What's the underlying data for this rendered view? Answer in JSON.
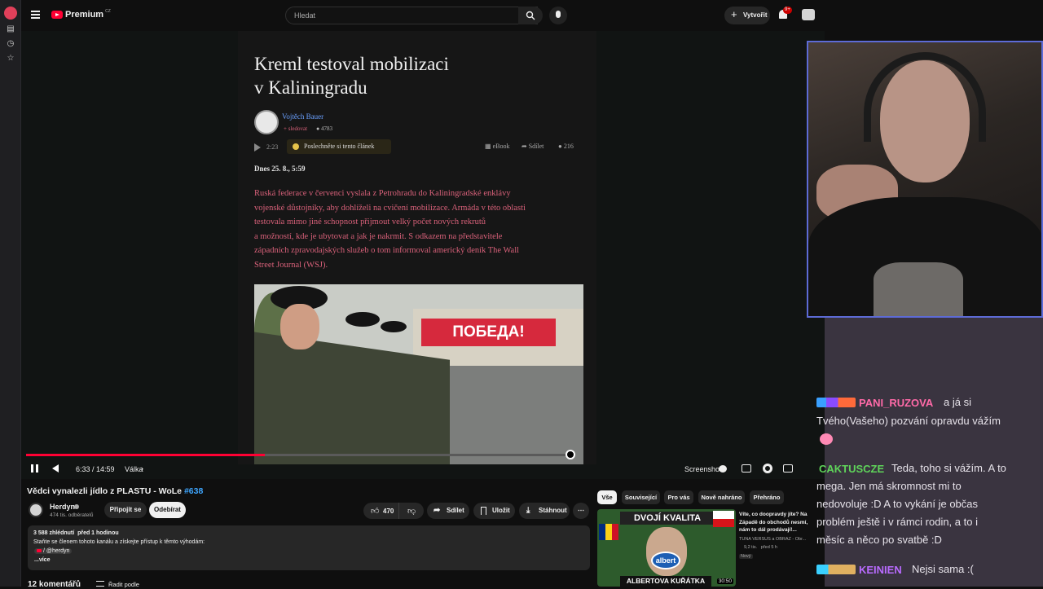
{
  "app": {
    "brand": "Premium",
    "country": "CZ",
    "search_placeholder": "Hledat",
    "create_label": "Vytvořit",
    "notif_badge": "9+"
  },
  "article": {
    "title_line1": "Kreml testoval mobilizaci",
    "title_line2": "v Kaliningradu",
    "author": "Vojtěch Bauer",
    "follow": "sledovat",
    "followers": "4783",
    "audio_time": "2:23",
    "listen_label": "Poslechněte si tento článek",
    "ebook": "eBook",
    "share": "Sdílet",
    "comments": "216",
    "date": "Dnes 25. 8., 5:59",
    "lead_lines": [
      "Ruská federace v červenci vyslala z Petrohradu do Kaliningradské enklávy",
      "vojenské důstojníky, aby dohlíželi na cvičení mobilizace. Armáda v této oblasti",
      "testovala mimo jiné schopnost přijmout velký počet nových rekrutů",
      "a možností, kde je ubytovat a jak je nakrmit. S odkazem na představitele",
      "západních zpravodajských služeb o tom informoval americký deník The Wall",
      "Street Journal (WSJ)."
    ],
    "photo_banner": "ПОБЕДА!"
  },
  "player": {
    "time": "6:33 / 14:59",
    "chapter": "Válka",
    "screenshot_label": "Screenshot",
    "progress": 0.437
  },
  "video": {
    "title": "Vědci vynalezli jídlo z PLASTU - WoLe",
    "tag": "#638",
    "channel": "Herdyn",
    "subscribers": "474 tis. odběratelů",
    "join": "Připojit se",
    "subscribe": "Odebírat",
    "likes": "470",
    "share": "Sdílet",
    "save": "Uložit",
    "download": "Stáhnout",
    "desc_stats": "3 588 zhlédnutí  před 1 hodinou",
    "desc_line": "Staňte se členem tohoto kanálu a získejte přístup k těmto výhodám:",
    "desc_link": "/ @herdyn",
    "desc_more": "...více",
    "comments_count": "12 komentářů",
    "sort_label": "Řadit podle"
  },
  "chips": [
    "Vše",
    "Související",
    "Pro vás",
    "Nově nahráno",
    "Přehráno"
  ],
  "rec": {
    "thumb_top": "DVOJÍ KVALITA",
    "thumb_bottom": "ALBERTOVA KUŘÁTKA",
    "thumb_brand": "albert",
    "duration": "30:50",
    "title": "Víte, co doopravdy jíte? Na Západě do obchodů nesmí, nám to dál prodávají!...",
    "channel": "TUNA VERSUS a OBRAZ - Obr...",
    "meta": "9,2 tis.   před 5 h",
    "badge": "Nový"
  },
  "chat": [
    {
      "name": "PANI_RUZOVA",
      "color": "#ff6aa8",
      "text_lines": [
        "a já si",
        "Tvého(Vašeho) pozvání opravdu vážím"
      ]
    },
    {
      "name": "CAKTUSCZE",
      "color": "#5fd45a",
      "text_lines": [
        "Teda, toho si vážím. A to",
        "mega. Jen má skromnost mi to",
        "nedovoluje :D A to vykání je občas",
        "problém ještě i v rámci rodin, a to i",
        "měsíc a něco po svatbě :D"
      ]
    },
    {
      "name": "KEINIEN",
      "color": "#b96bff",
      "text_lines": [
        "Nejsi sama :("
      ]
    }
  ],
  "colors": {
    "accent_red": "#ff0033",
    "lead_pink": "#d9617a",
    "link_blue": "#3ea6ff"
  }
}
